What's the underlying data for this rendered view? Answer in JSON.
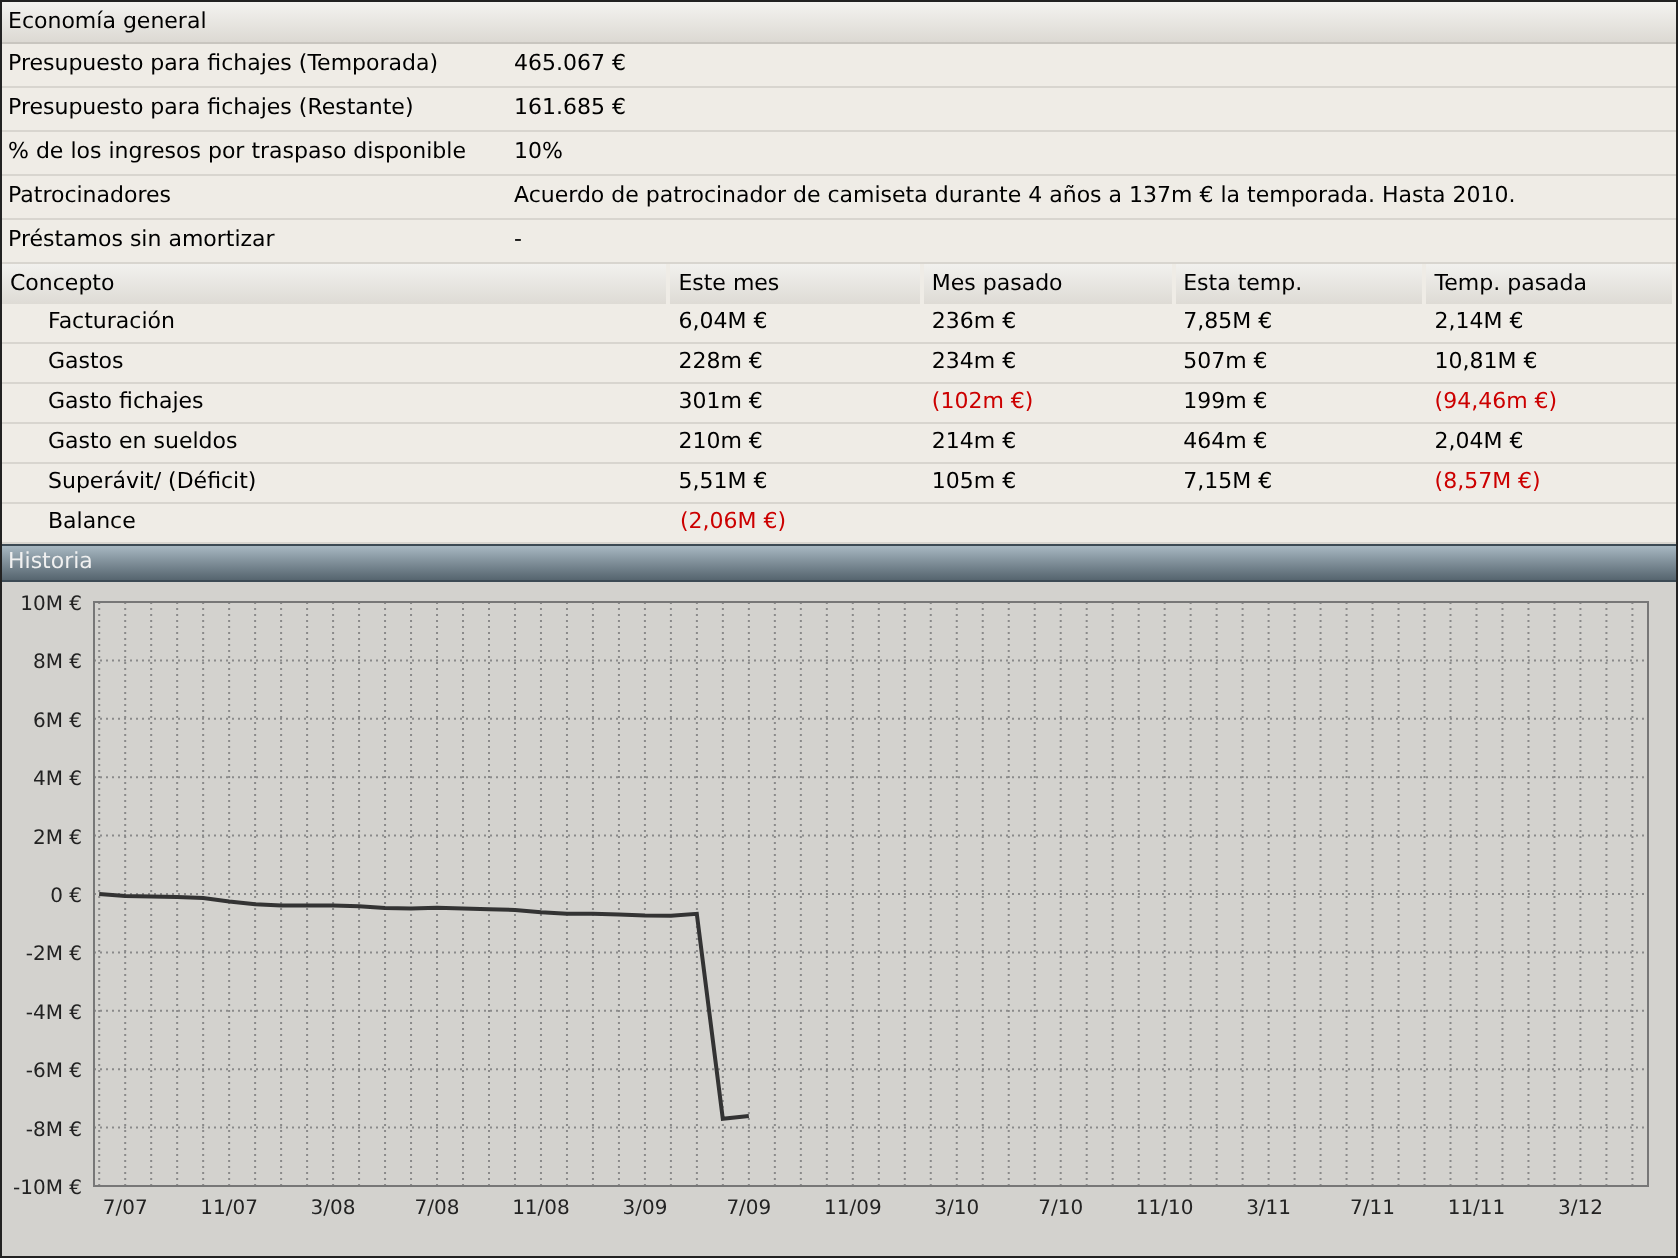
{
  "summary": {
    "title": "Economía general",
    "rows": [
      {
        "label": "Presupuesto para fichajes (Temporada)",
        "value": "465.067 €"
      },
      {
        "label": "Presupuesto para fichajes (Restante)",
        "value": "161.685 €"
      },
      {
        "label": "% de los ingresos por traspaso disponible",
        "value": "10%"
      },
      {
        "label": "Patrocinadores",
        "value": "Acuerdo de patrocinador de camiseta durante 4 años a 137m € la temporada. Hasta 2010."
      },
      {
        "label": "Préstamos sin amortizar",
        "value": "-"
      }
    ]
  },
  "table": {
    "columns": [
      "Concepto",
      "Este mes",
      "Mes pasado",
      "Esta temp.",
      "Temp. pasada"
    ],
    "rows": [
      {
        "cells": [
          {
            "text": "Facturación",
            "negative": false
          },
          {
            "text": "6,04M €",
            "negative": false
          },
          {
            "text": "236m €",
            "negative": false
          },
          {
            "text": "7,85M €",
            "negative": false
          },
          {
            "text": "2,14M €",
            "negative": false
          }
        ]
      },
      {
        "cells": [
          {
            "text": "Gastos",
            "negative": false
          },
          {
            "text": "228m €",
            "negative": false
          },
          {
            "text": "234m €",
            "negative": false
          },
          {
            "text": "507m €",
            "negative": false
          },
          {
            "text": "10,81M €",
            "negative": false
          }
        ]
      },
      {
        "cells": [
          {
            "text": "Gasto fichajes",
            "negative": false
          },
          {
            "text": "301m €",
            "negative": false
          },
          {
            "text": "(102m €)",
            "negative": true
          },
          {
            "text": "199m €",
            "negative": false
          },
          {
            "text": "(94,46m €)",
            "negative": true
          }
        ]
      },
      {
        "cells": [
          {
            "text": "Gasto en sueldos",
            "negative": false
          },
          {
            "text": "210m €",
            "negative": false
          },
          {
            "text": "214m €",
            "negative": false
          },
          {
            "text": "464m €",
            "negative": false
          },
          {
            "text": "2,04M €",
            "negative": false
          }
        ]
      },
      {
        "cells": [
          {
            "text": "Superávit/ (Déficit)",
            "negative": false
          },
          {
            "text": "5,51M €",
            "negative": false
          },
          {
            "text": "105m €",
            "negative": false
          },
          {
            "text": "7,15M €",
            "negative": false
          },
          {
            "text": "(8,57M €)",
            "negative": true
          }
        ]
      },
      {
        "cells": [
          {
            "text": "Balance",
            "negative": false
          },
          {
            "text": "(2,06M €)",
            "negative": true
          }
        ]
      }
    ]
  },
  "history": {
    "title": "Historia",
    "chart_data": {
      "type": "line",
      "grid": true,
      "ylim": [
        -10,
        10
      ],
      "categories": [
        null,
        "7/07",
        null,
        null,
        null,
        "11/07",
        null,
        null,
        null,
        "3/08",
        null,
        null,
        null,
        "7/08",
        null,
        null,
        null,
        "11/08",
        null,
        null,
        null,
        "3/09",
        null,
        null,
        null,
        "7/09",
        null,
        null,
        null,
        "11/09",
        null,
        null,
        null,
        "3/10",
        null,
        null,
        null,
        "7/10",
        null,
        null,
        null,
        "11/10",
        null,
        null,
        null,
        "3/11",
        null,
        null,
        null,
        "7/11",
        null,
        null,
        null,
        "11/11",
        null,
        null,
        null,
        "3/12",
        null,
        null
      ],
      "yticks": [
        {
          "value": 10,
          "label": "10M €"
        },
        {
          "value": 8,
          "label": "8M €"
        },
        {
          "value": 6,
          "label": "6M €"
        },
        {
          "value": 4,
          "label": "4M €"
        },
        {
          "value": 2,
          "label": "2M €"
        },
        {
          "value": 0,
          "label": "0 €"
        },
        {
          "value": -2,
          "label": "-2M €"
        },
        {
          "value": -4,
          "label": "-4M €"
        },
        {
          "value": -6,
          "label": "-6M €"
        },
        {
          "value": -8,
          "label": "-8M €"
        },
        {
          "value": -10,
          "label": "-10M €"
        }
      ],
      "series": [
        {
          "color": "#333333",
          "values": [
            0,
            -0.07,
            -0.08,
            -0.1,
            -0.14,
            -0.25,
            -0.35,
            -0.4,
            -0.4,
            -0.4,
            -0.42,
            -0.48,
            -0.5,
            -0.47,
            -0.5,
            -0.52,
            -0.55,
            -0.62,
            -0.68,
            -0.68,
            -0.7,
            -0.74,
            -0.75,
            -0.68,
            -7.7,
            -7.6,
            null,
            null,
            null,
            null,
            null,
            null,
            null,
            null,
            null,
            null,
            null,
            null,
            null,
            null,
            null,
            null,
            null,
            null,
            null,
            null,
            null,
            null,
            null,
            null,
            null,
            null,
            null,
            null,
            null,
            null,
            null,
            null,
            null,
            null
          ]
        }
      ]
    }
  }
}
